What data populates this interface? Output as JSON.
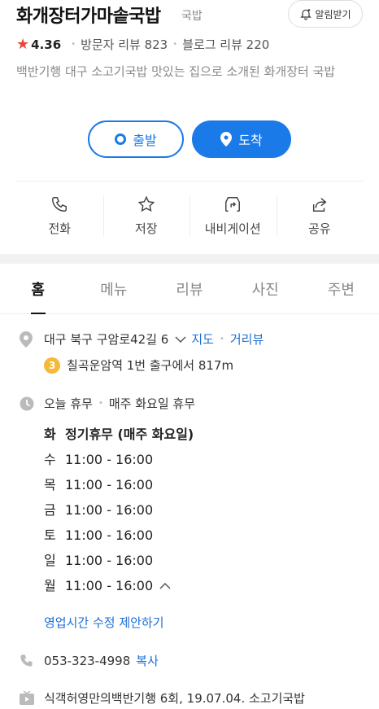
{
  "header": {
    "title": "화개장터가마솥국밥",
    "category": "국밥",
    "alarm_label": "알림받기"
  },
  "rating": {
    "star": "★",
    "score": "4.36",
    "visitor_reviews": "방문자 리뷰 823",
    "blog_reviews": "블로그 리뷰 220"
  },
  "description": "백반기행 대구 소고기국밥 맛있는 집으로 소개된 화개장터 국밥",
  "route": {
    "start_label": "출발",
    "arrive_label": "도착"
  },
  "actions": [
    {
      "label": "전화",
      "icon": "phone-icon"
    },
    {
      "label": "저장",
      "icon": "star-icon"
    },
    {
      "label": "내비게이션",
      "icon": "navigation-icon"
    },
    {
      "label": "공유",
      "icon": "share-icon"
    }
  ],
  "tabs": [
    "홈",
    "메뉴",
    "리뷰",
    "사진",
    "주변"
  ],
  "address": {
    "text": "대구 북구 구암로42길 6",
    "map_link": "지도",
    "street_view_link": "거리뷰",
    "subway_line": "3",
    "subway_text": "칠곡운암역 1번 출구에서 817m"
  },
  "status": {
    "today": "오늘 휴무",
    "note": "매주 화요일 휴무"
  },
  "hours": [
    {
      "day": "화",
      "time": "정기휴무 (매주 화요일)"
    },
    {
      "day": "수",
      "time": "11:00 - 16:00"
    },
    {
      "day": "목",
      "time": "11:00 - 16:00"
    },
    {
      "day": "금",
      "time": "11:00 - 16:00"
    },
    {
      "day": "토",
      "time": "11:00 - 16:00"
    },
    {
      "day": "일",
      "time": "11:00 - 16:00"
    },
    {
      "day": "월",
      "time": "11:00 - 16:00"
    }
  ],
  "suggest_label": "영업시간 수정 제안하기",
  "phone": {
    "number": "053-323-4998",
    "copy_label": "복사"
  },
  "tv": {
    "text": "식객허영만의백반기행 6회, 19.07.04. 소고기국밥"
  },
  "colors": {
    "accent": "#1a7ae8",
    "star": "#e8473a",
    "subway_line_3": "#f5b93a"
  }
}
